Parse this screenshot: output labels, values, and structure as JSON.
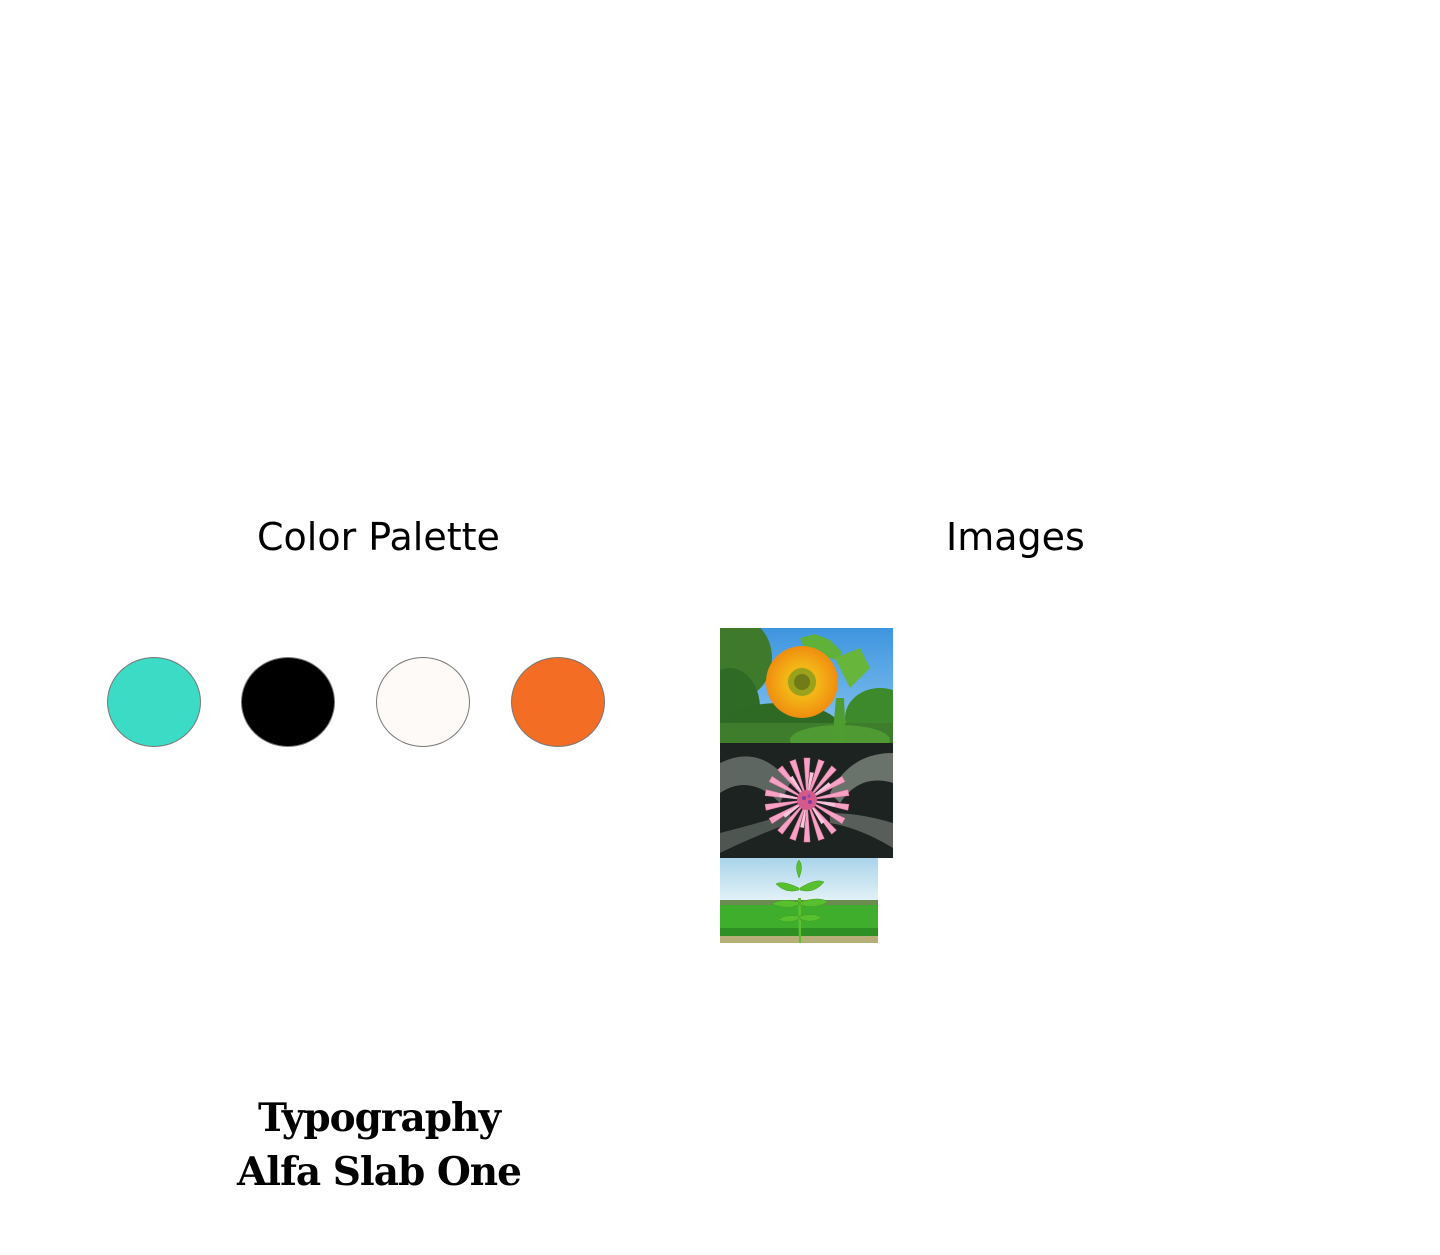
{
  "color_palette": {
    "title": "Color Palette",
    "swatches": [
      {
        "name": "turquoise",
        "color": "#3cdbc6"
      },
      {
        "name": "black",
        "color": "#000000"
      },
      {
        "name": "off-white",
        "color": "#fdfaf7"
      },
      {
        "name": "orange",
        "color": "#f36d24"
      }
    ]
  },
  "images": {
    "title": "Images",
    "items": [
      {
        "name": "sunflower-photo",
        "subject": "sunflower"
      },
      {
        "name": "pink-flower-photo",
        "subject": "pink bromeliad flower"
      },
      {
        "name": "green-plant-photo",
        "subject": "green plant in field"
      }
    ]
  },
  "typography": {
    "heading": "Typography",
    "font_name": "Alfa Slab One"
  }
}
